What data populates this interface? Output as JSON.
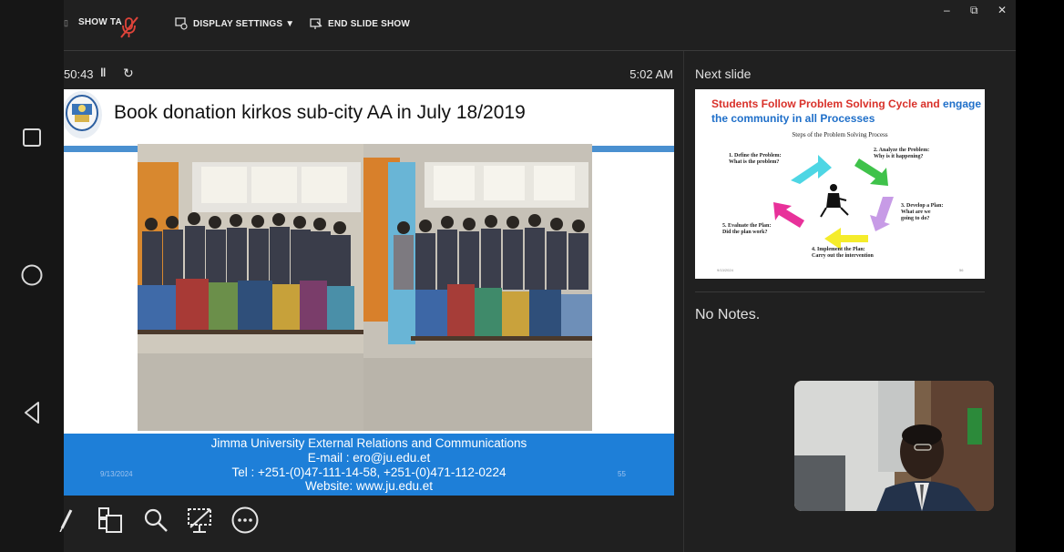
{
  "toolbar": {
    "show_taskbar_label": "SHOW TA",
    "display_settings_label": "DISPLAY SETTINGS ▼",
    "end_show_label": "END SLIDE SHOW",
    "window_minimize": "–",
    "window_restore": "⧉",
    "window_close": "✕"
  },
  "presenter": {
    "elapsed_time": "50:43",
    "clock": "5:02 AM"
  },
  "slide": {
    "title": "Book donation kirkos sub-city AA in July 18/2019",
    "footer_org": "Jimma University External Relations and Communications",
    "footer_email": "E-mail : ero@ju.edu.et",
    "footer_tel": "Tel : +251-(0)47-111-14-58, +251-(0)471-112-0224",
    "footer_web": "Website: www.ju.edu.et",
    "date": "9/13/2024",
    "page_number": "55"
  },
  "next_slide": {
    "label": "Next slide",
    "title_red": "Students Follow Problem Solving Cycle and",
    "title_blue_1": "engage",
    "title_blue_2": "the community in all Processes",
    "subtitle": "Steps of the Problem Solving Process",
    "step1_a": "1. Define the Problem:",
    "step1_b": "What is the problem?",
    "step2_a": "2. Analyze the Problem:",
    "step2_b": "Why is it happening?",
    "step3_a": "3. Develop a Plan:",
    "step3_b": "What are we",
    "step3_c": "going to do?",
    "step4_a": "4. Implement the Plan:",
    "step4_b": "Carry out the intervention",
    "step5_a": "5. Evaluate the Plan:",
    "step5_b": "Did the plan work?",
    "date": "9/13/2024",
    "page_number": "56"
  },
  "notes": {
    "text": "No Notes."
  },
  "colors": {
    "slide_band": "#4a90d0",
    "footer_band": "#1e7fd8",
    "title_red": "#d9312a",
    "title_blue": "#1f6fc9",
    "mic_off": "#e0443a"
  }
}
